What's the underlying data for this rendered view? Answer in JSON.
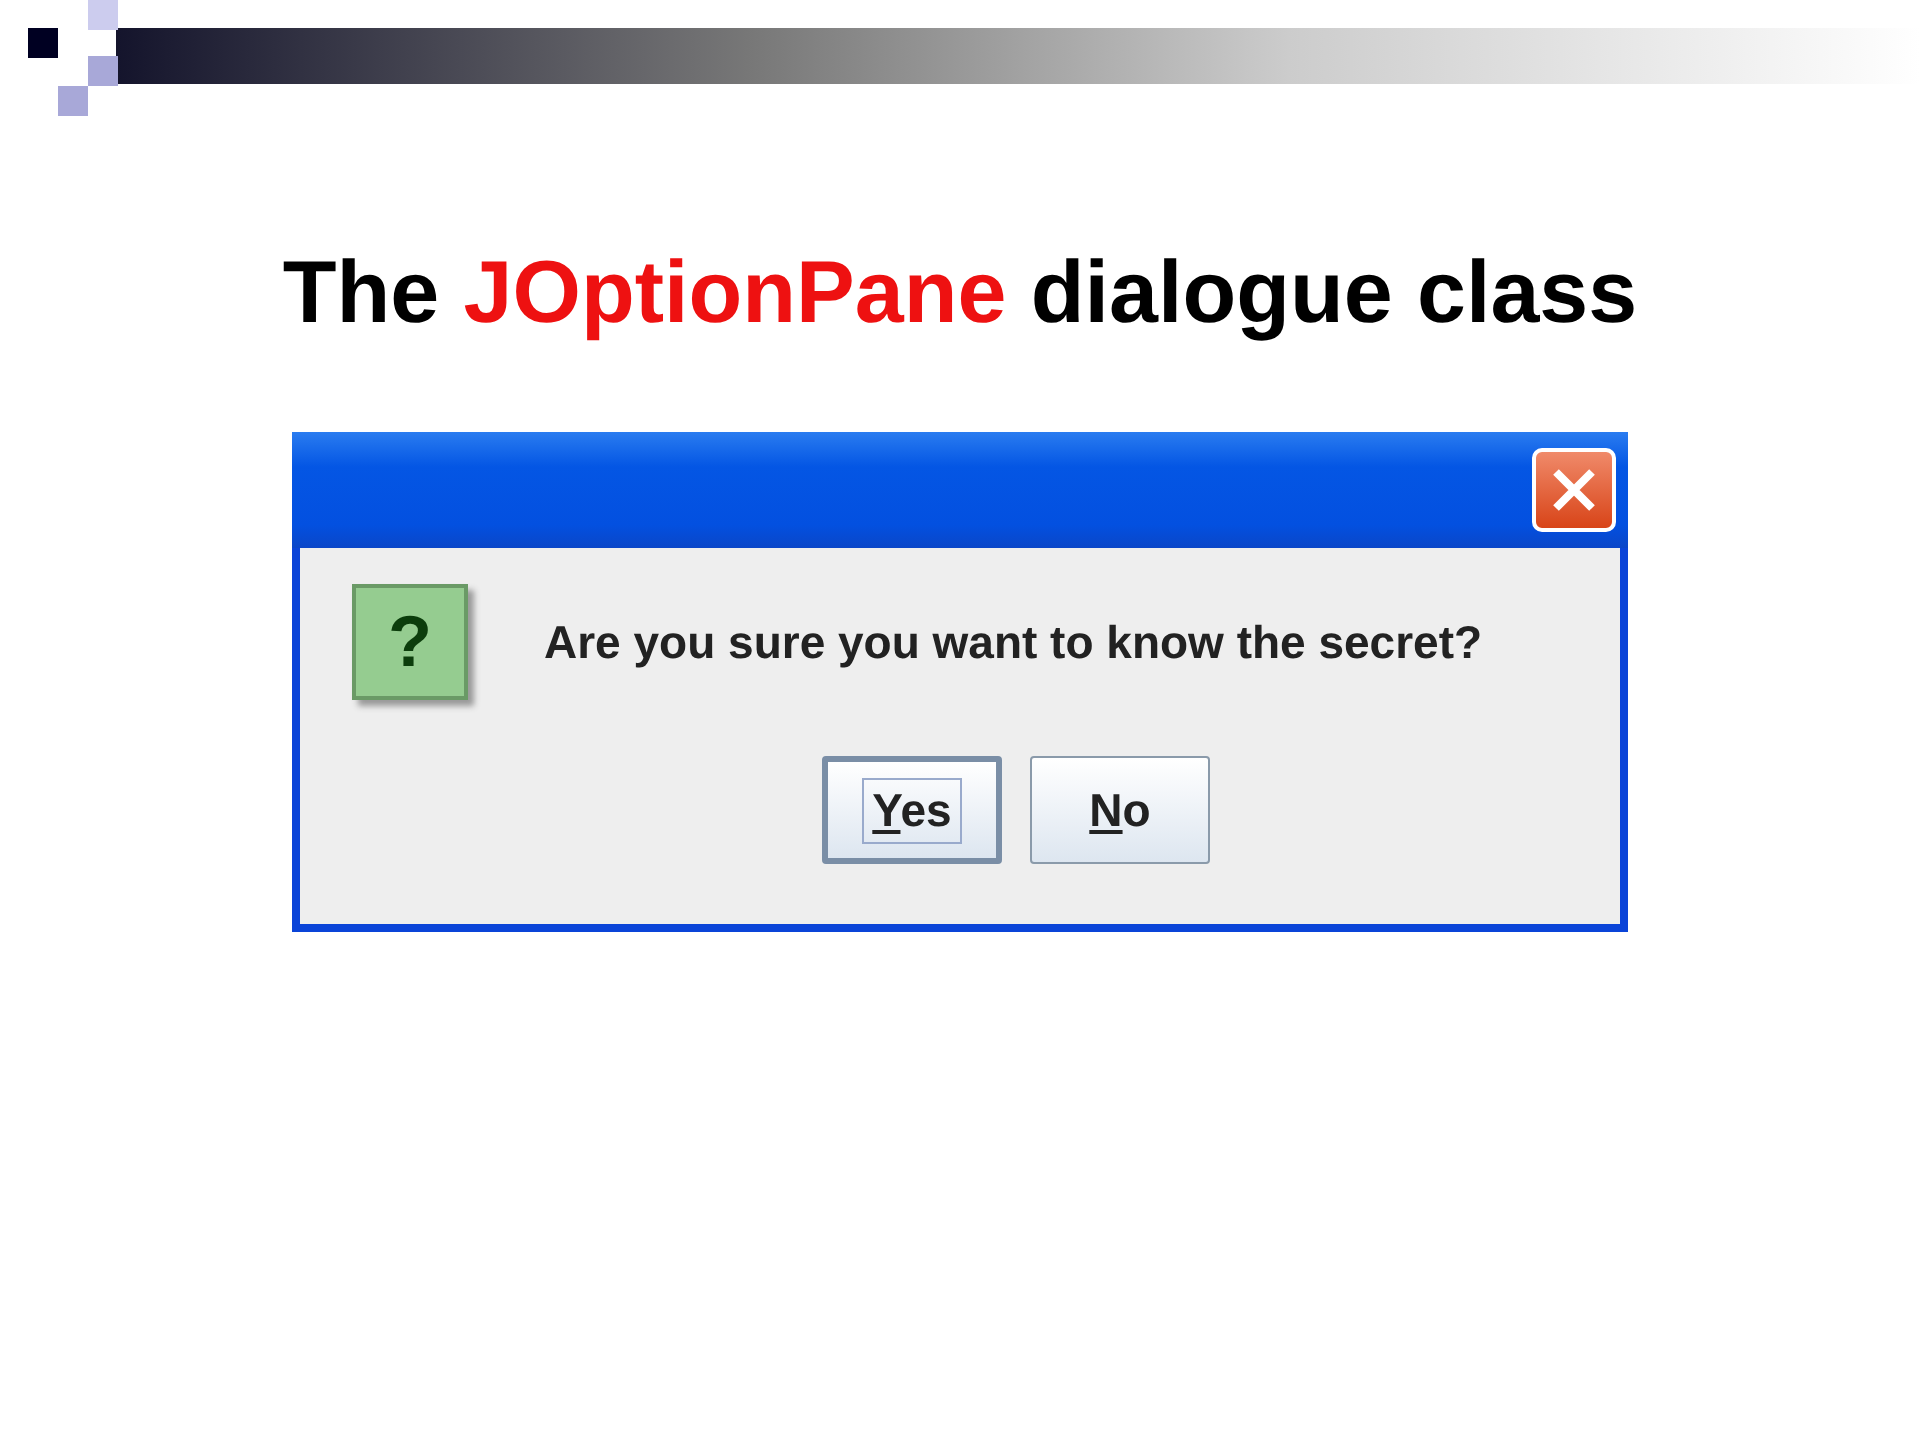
{
  "slide": {
    "title": [
      {
        "text": "The ",
        "kind": "plain"
      },
      {
        "text": "JOptionPane",
        "kind": "highlight"
      },
      {
        "text": " dialogue class",
        "kind": "plain"
      }
    ]
  },
  "dialog": {
    "icon": "?",
    "message": "Are you sure you want to know the secret?",
    "buttons": [
      {
        "label": "Yes",
        "focused": true
      },
      {
        "label": "No",
        "focused": false
      }
    ]
  }
}
